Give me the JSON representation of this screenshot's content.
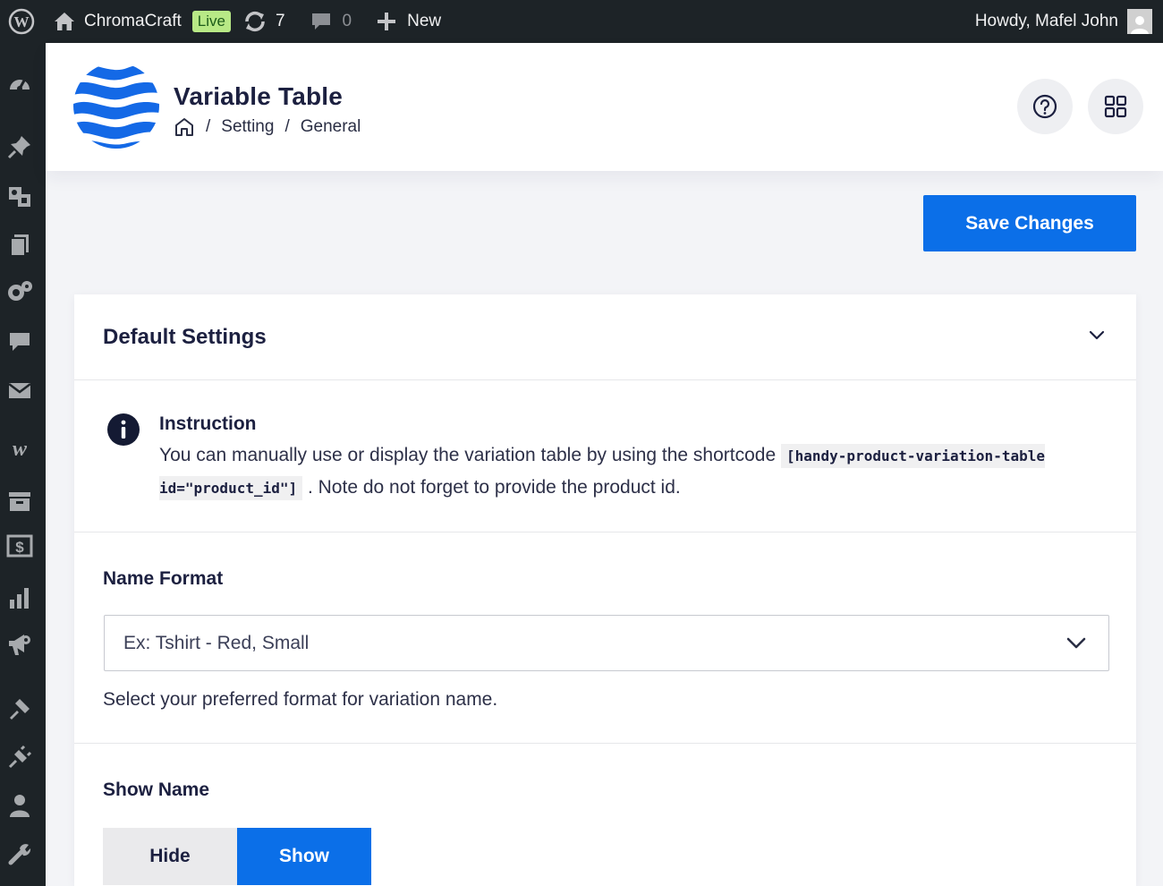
{
  "adminbar": {
    "site_name": "ChromaCraft",
    "live_badge": "Live",
    "updates_count": "7",
    "comments_count": "0",
    "new_label": "New",
    "greeting": "Howdy, Mafel John"
  },
  "sidebar": {
    "icons": [
      "dashboard-icon",
      "posts-pin-icon",
      "media-icon",
      "pages-icon",
      "gear-users-icon",
      "comments-icon",
      "mail-icon",
      "woocommerce-icon",
      "products-icon",
      "payments-icon",
      "analytics-icon",
      "marketing-icon",
      "appearance-icon",
      "plugins-icon",
      "users-icon",
      "tools-icon"
    ]
  },
  "header": {
    "title": "Variable Table",
    "breadcrumb": [
      "Setting",
      "General"
    ],
    "separator": "/"
  },
  "actions": {
    "save_label": "Save Changes"
  },
  "card": {
    "title": "Default Settings",
    "instruction": {
      "title": "Instruction",
      "text_before": "You can manually use or display the variation table by using the shortcode",
      "shortcode": "[handy-product-variation-table id=\"product_id\"]",
      "text_after": ". Note do not forget to provide the product id."
    },
    "name_format": {
      "label": "Name Format",
      "selected": "Ex: Tshirt - Red, Small",
      "help": "Select your preferred format for variation name."
    },
    "show_name": {
      "label": "Show Name",
      "options": [
        "Hide",
        "Show"
      ],
      "selected": "Show"
    }
  },
  "colors": {
    "accent": "#0b6fe8",
    "adminbar_bg": "#1d2327",
    "page_bg": "#f3f4f7"
  }
}
